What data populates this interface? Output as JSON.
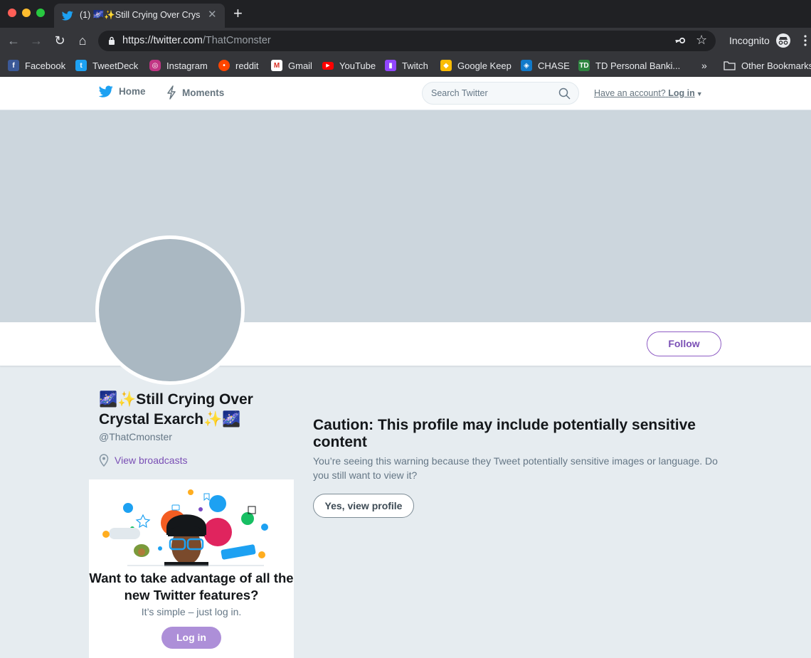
{
  "browser": {
    "tab": {
      "title": "(1) 🌌✨Still Crying Over Crys",
      "favicon": "twitter-bird-icon"
    },
    "url": {
      "host": "https://twitter.com",
      "path": "/ThatCmonster"
    },
    "incognito_label": "Incognito",
    "bookmarks": [
      {
        "label": "Facebook",
        "icon": "facebook-icon",
        "color": "#3b5998"
      },
      {
        "label": "TweetDeck",
        "icon": "tweetdeck-icon",
        "color": "#1da1f2"
      },
      {
        "label": "Instagram",
        "icon": "instagram-icon",
        "color": "#c13584"
      },
      {
        "label": "reddit",
        "icon": "reddit-icon",
        "color": "#ff4500"
      },
      {
        "label": "Gmail",
        "icon": "gmail-icon",
        "color": "#d93025"
      },
      {
        "label": "YouTube",
        "icon": "youtube-icon",
        "color": "#ff0000"
      },
      {
        "label": "Twitch",
        "icon": "twitch-icon",
        "color": "#9146ff"
      },
      {
        "label": "Google Keep",
        "icon": "keep-icon",
        "color": "#fbbc04"
      },
      {
        "label": "CHASE",
        "icon": "chase-icon",
        "color": "#117aca"
      },
      {
        "label": "TD Personal Banki...",
        "icon": "td-icon",
        "color": "#2e8540"
      }
    ],
    "bookmarks_more": "»",
    "other_bookmarks": "Other Bookmarks"
  },
  "twitter_nav": {
    "home": "Home",
    "moments": "Moments",
    "search_placeholder": "Search Twitter",
    "account_prompt": "Have an account?",
    "login": "Log in"
  },
  "profile": {
    "follow_label": "Follow",
    "name": "🌌✨Still Crying Over Crystal Exarch✨🌌",
    "handle": "@ThatCmonster",
    "broadcasts_link": "View broadcasts"
  },
  "login_card": {
    "title": "Want to take advantage of all the new Twitter features?",
    "subtitle": "It’s simple – just log in.",
    "button": "Log in"
  },
  "caution": {
    "title": "Caution: This profile may include potentially sensitive content",
    "text": "You’re seeing this warning because they Tweet potentially sensitive images or language. Do you still want to view it?",
    "button": "Yes, view profile"
  },
  "colors": {
    "accent_purple": "#7a4fb5",
    "twitter_blue": "#1da1f2",
    "banner": "#ccd6dd",
    "avatar": "#aab8c2",
    "page_bg": "#e6ecf0"
  }
}
